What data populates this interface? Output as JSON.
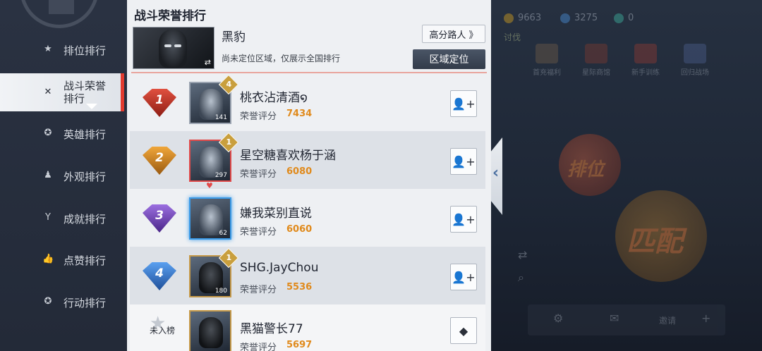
{
  "nav": {
    "items": [
      {
        "label": "排位排行",
        "icon": "star-icon"
      },
      {
        "label": "战斗荣誉排行",
        "icon": "crossed-swords-icon"
      },
      {
        "label": "英雄排行",
        "icon": "hero-icon"
      },
      {
        "label": "外观排行",
        "icon": "shirt-icon"
      },
      {
        "label": "成就排行",
        "icon": "trophy-icon"
      },
      {
        "label": "点赞排行",
        "icon": "thumbs-up-icon"
      },
      {
        "label": "行动排行",
        "icon": "action-icon"
      }
    ],
    "active_label_line1": "战斗荣誉",
    "active_label_line2": "排行"
  },
  "panel": {
    "title": "战斗荣誉排行",
    "hero_name": "黑豹",
    "note": "尚未定位区域，仅展示全国排行",
    "path_button": "高分路人 》",
    "region_button": "区域定位"
  },
  "players": [
    {
      "rank": "1",
      "name": "桃衣沾清酒໑",
      "score_label": "荣誉评分",
      "score": "7434",
      "level": "141",
      "badge": "4"
    },
    {
      "rank": "2",
      "name": "星空糖喜欢杨于涵",
      "score_label": "荣誉评分",
      "score": "6080",
      "level": "297",
      "badge": "1"
    },
    {
      "rank": "3",
      "name": "嫌我菜别直说",
      "score_label": "荣誉评分",
      "score": "6060",
      "level": "62",
      "badge": ""
    },
    {
      "rank": "4",
      "name": "SHG.JayChou",
      "score_label": "荣誉评分",
      "score": "5536",
      "level": "180",
      "badge": "1"
    }
  ],
  "self": {
    "rank_label": "未入榜",
    "name": "黑猫警长77",
    "score_label": "荣誉评分",
    "score": "5697"
  },
  "right": {
    "res1": "9663",
    "res2": "3275",
    "res3": "0",
    "top_label": "讨伐",
    "gifts": [
      "首充福利",
      "星际商馆",
      "新手训练",
      "回归战场"
    ],
    "ball1_text": "排位",
    "ball2_text": "匹配",
    "invite": "邀请"
  },
  "colors": {
    "accent_red": "#e23b2f",
    "score_orange": "#e08a1c",
    "rank1": "#c0392b",
    "rank2": "#d68a1f",
    "rank3": "#7c4fc2",
    "rank4": "#3d7fd6"
  }
}
